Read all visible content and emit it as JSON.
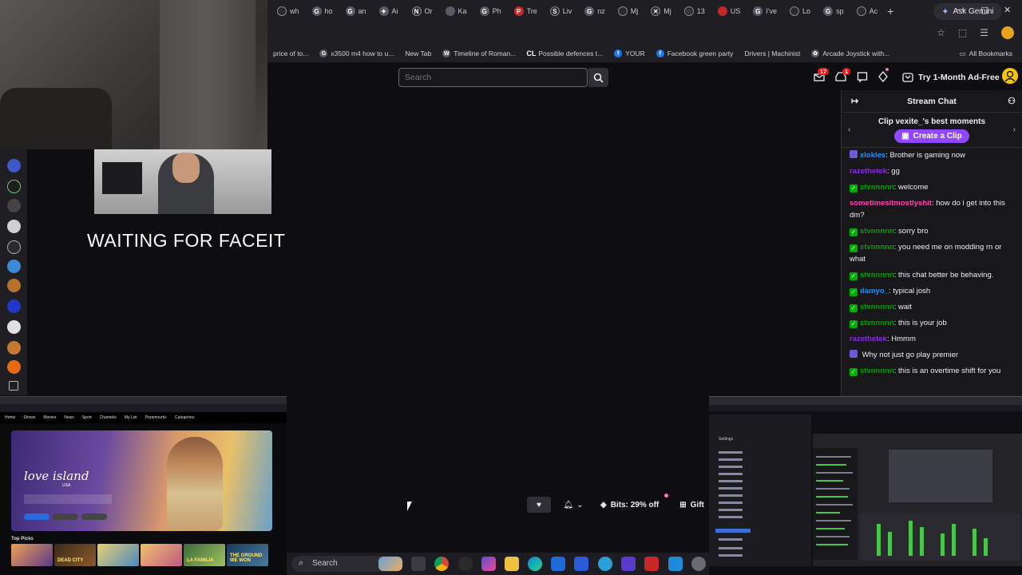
{
  "browser": {
    "tabs": [
      {
        "label": "wh",
        "icon": "generic-favicon"
      },
      {
        "label": "ho",
        "icon": "google-favicon"
      },
      {
        "label": "an",
        "icon": "google-favicon"
      },
      {
        "label": "Ai",
        "icon": "gemini-favicon"
      },
      {
        "label": "Or",
        "icon": "nz-favicon"
      },
      {
        "label": "Ka",
        "icon": "generic-favicon"
      },
      {
        "label": "Ph",
        "icon": "google-favicon"
      },
      {
        "label": "Tre",
        "icon": "red-favicon"
      },
      {
        "label": "Liv",
        "icon": "sp-favicon"
      },
      {
        "label": "nz",
        "icon": "google-favicon"
      },
      {
        "label": "Mj",
        "icon": "generic-favicon"
      },
      {
        "label": "Mj",
        "icon": "close-favicon"
      },
      {
        "label": "13",
        "icon": "loading-favicon"
      },
      {
        "label": "US",
        "icon": "red-favicon"
      },
      {
        "label": "I've",
        "icon": "google-favicon"
      },
      {
        "label": "Lo",
        "icon": "generic-favicon"
      },
      {
        "label": "sp",
        "icon": "google-favicon"
      },
      {
        "label": "Ac",
        "icon": "generic-favicon"
      }
    ],
    "new_tab_symbol": "+",
    "ask_gemini_label": "Ask Gemini",
    "window_controls": [
      "—",
      "▢",
      "✕"
    ],
    "bookmarks": [
      {
        "label": "price of to...",
        "icon": "none"
      },
      {
        "label": "x3500 m4 how to u...",
        "icon": "google"
      },
      {
        "label": "New Tab",
        "icon": "none"
      },
      {
        "label": "Timeline of Roman...",
        "icon": "W"
      },
      {
        "label": "Possible defences t...",
        "icon": "CL"
      },
      {
        "label": "YOUR",
        "icon": "facebook"
      },
      {
        "label": "Facebook green party",
        "icon": "facebook"
      },
      {
        "label": "Drivers | Machinist",
        "icon": "none"
      },
      {
        "label": "Arcade Joystick with...",
        "icon": "generic"
      }
    ],
    "all_bookmarks_label": "All Bookmarks"
  },
  "twitch_header": {
    "search_placeholder": "Search",
    "notifications_count": "17",
    "inbox_count": "1",
    "ad_free_label": "Try 1-Month Ad-Free"
  },
  "stream": {
    "overlay_text": "WAITING FOR FACEIT"
  },
  "chat": {
    "title": "Stream Chat",
    "clip_title": "Clip vexite_'s best moments",
    "clip_button": "Create a Clip",
    "messages": [
      {
        "user": "xlokles",
        "text": "Brother is gaming now",
        "color": "blue",
        "badge": "sub"
      },
      {
        "user": "razethetek",
        "text": "gg",
        "color": "purple",
        "badge": ""
      },
      {
        "user": "stvnnnnn",
        "text": "welcome",
        "color": "green",
        "badge": "mod"
      },
      {
        "user": "sometimesitmostlyshit",
        "text": "how do i get into this dm?",
        "color": "pink",
        "badge": ""
      },
      {
        "user": "stvnnnnn",
        "text": "sorry bro",
        "color": "green",
        "badge": "mod"
      },
      {
        "user": "stvnnnnn",
        "text": "you need me on modding rn or what",
        "color": "green",
        "badge": "mod"
      },
      {
        "user": "stvnnnnn",
        "text": "this chat better be behaving.",
        "color": "green",
        "badge": "mod"
      },
      {
        "user": "damyo_",
        "text": "typical josh",
        "color": "blue",
        "badge": "mod"
      },
      {
        "user": "stvnnnnn",
        "text": "wait",
        "color": "green",
        "badge": "mod"
      },
      {
        "user": "stvnnnnn",
        "text": "this is your job",
        "color": "green",
        "badge": "mod"
      },
      {
        "user": "razethetek",
        "text": "Hmmm",
        "color": "purple",
        "badge": ""
      },
      {
        "user": "",
        "text": "Why not just go play premier",
        "color": "navy",
        "badge": "sub"
      },
      {
        "user": "stvnnnnn",
        "text": "this is an overtime shift for you",
        "color": "green",
        "badge": "mod"
      }
    ]
  },
  "player": {
    "bits_label": "Bits: 29% off",
    "gift_label": "Gift"
  },
  "thumb_left": {
    "menu": [
      "Home",
      "Shows",
      "Movies",
      "News",
      "Sport",
      "Channels",
      "My List",
      "Paramount+",
      "Categories"
    ],
    "promo_title": "love island",
    "promo_sub": "USA",
    "top_picks_label": "Top Picks",
    "pick_labels": [
      "",
      "DEAD CITY",
      "",
      "",
      "LA FAMILIA",
      "THE GROUND WE WON"
    ]
  },
  "thumb_right": {
    "settings_label": "Settings"
  },
  "taskbar": {
    "search_placeholder": "Search"
  },
  "colors": {
    "twitch_purple": "#9147ff",
    "mod_green": "#00ad03",
    "bg": "#0e0e10"
  }
}
